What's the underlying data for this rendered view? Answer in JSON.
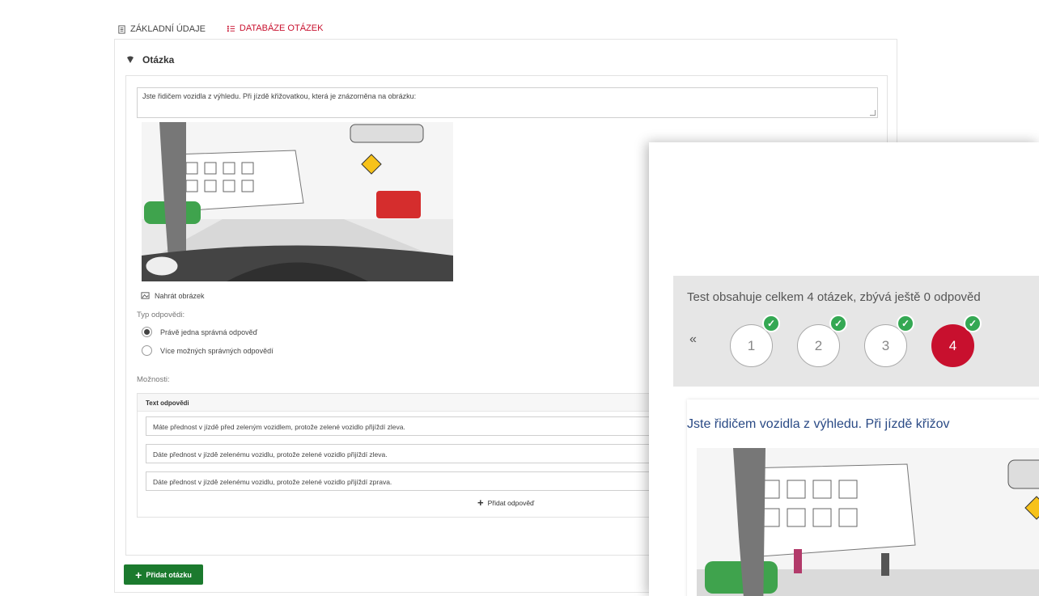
{
  "tabs": [
    {
      "label": "ZÁKLADNÍ ÚDAJE",
      "icon": "document-icon",
      "active": false
    },
    {
      "label": "DATABÁZE OTÁZEK",
      "icon": "list-icon",
      "active": true
    }
  ],
  "question_panel": {
    "heading": "Otázka",
    "question_text": "Jste řidičem vozidla z výhledu. Při jízdě křižovatkou, která je znázorněna na obrázku:",
    "upload_label": "Nahrát obrázek",
    "answer_type_label": "Typ odpovědi:",
    "answer_types": [
      {
        "label": "Právě jedna správná odpověď",
        "selected": true
      },
      {
        "label": "Více možných správných odpovědí",
        "selected": false
      }
    ],
    "options_label": "Možnosti:",
    "answers_header": "Text odpovědi",
    "answers": [
      "Máte přednost v jízdě před zeleným vozidlem, protože zelené vozidlo přijíždí zleva.",
      "Dáte přednost v jízdě zelenému vozidlu, protože zelené vozidlo přijíždí zleva.",
      "Dáte přednost v jízdě zelenému vozidlu, protože zelené vozidlo přijíždí zprava."
    ],
    "add_answer_label": "Přidat odpověď"
  },
  "add_question_label": "Přidat otázku",
  "preview": {
    "info_text": "Test obsahuje celkem 4 otázek, zbývá ještě 0 odpověd",
    "nav_back": "«",
    "questions": [
      {
        "number": "1",
        "answered": true,
        "active": false
      },
      {
        "number": "2",
        "answered": true,
        "active": false
      },
      {
        "number": "3",
        "answered": true,
        "active": false
      },
      {
        "number": "4",
        "answered": true,
        "active": true
      }
    ],
    "question_title": "Jste řidičem vozidla z výhledu. Při jízdě křižov"
  },
  "colors": {
    "accent": "#c8102e",
    "success": "#1b7a2e",
    "check": "#34a853",
    "title_blue": "#2a4a85"
  }
}
